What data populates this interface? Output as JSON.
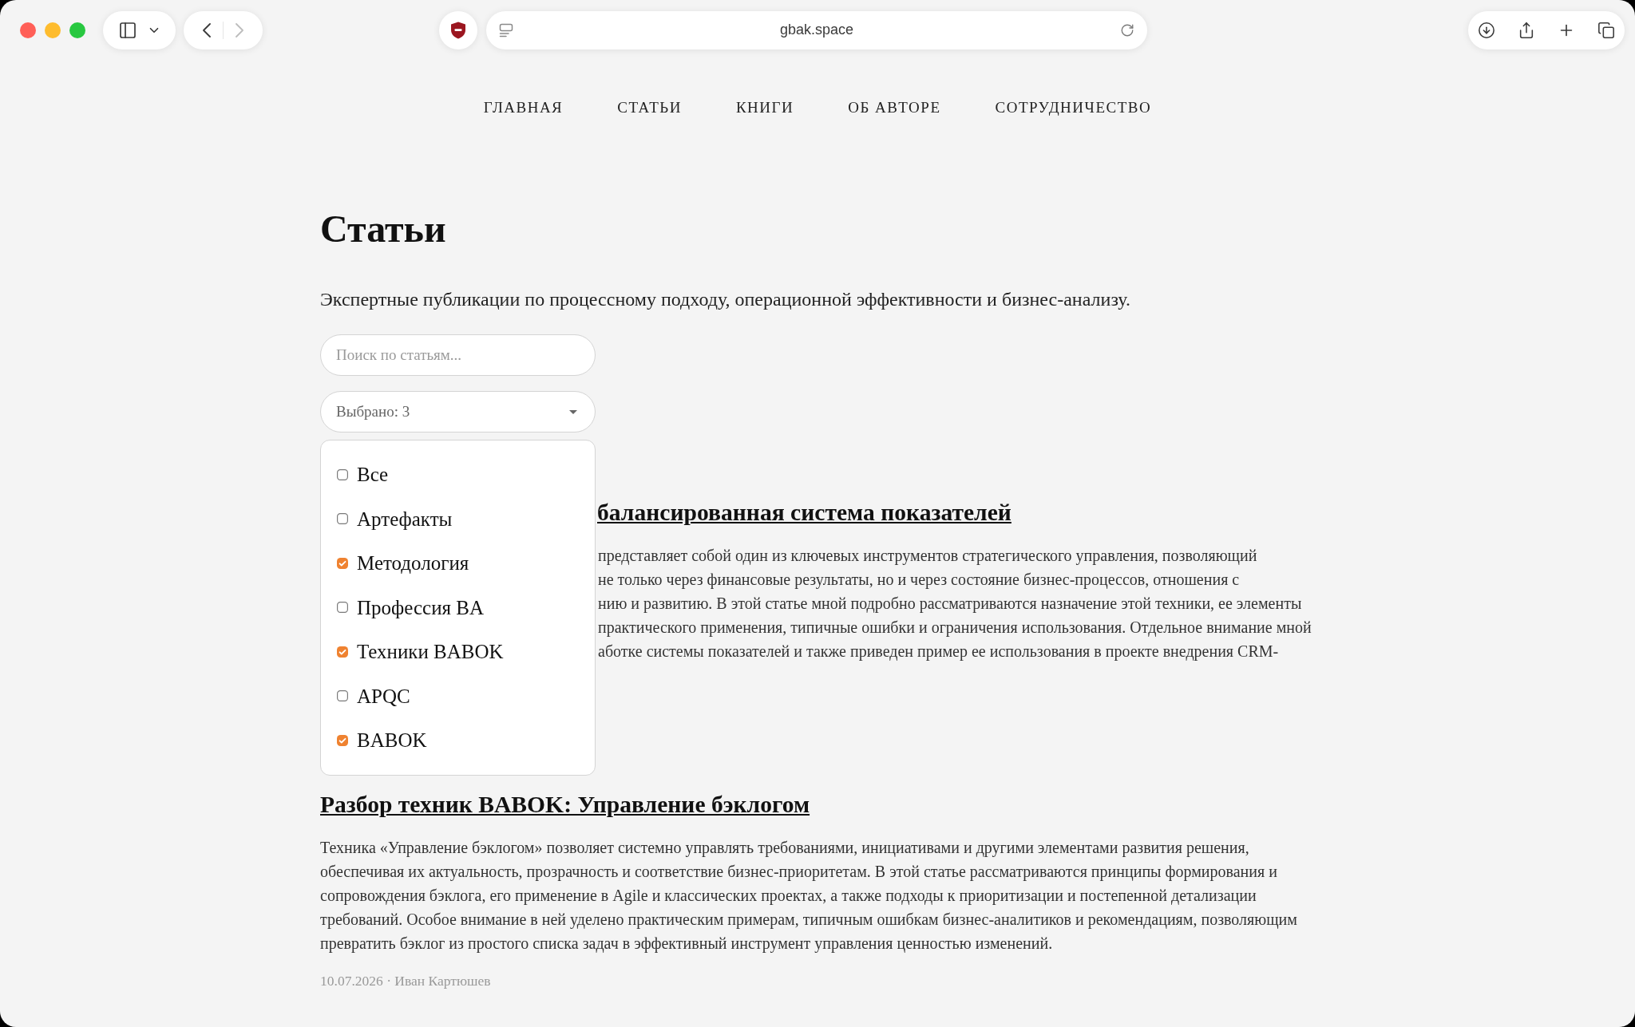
{
  "browser": {
    "address": "gbak.space",
    "back_disabled": false,
    "forward_disabled": true
  },
  "nav": [
    "ГЛАВНАЯ",
    "СТАТЬИ",
    "КНИГИ",
    "ОБ АВТОРЕ",
    "СОТРУДНИЧЕСТВО"
  ],
  "page": {
    "title": "Статьи",
    "subtitle": "Экспертные публикации по процессному подходу, операционной эффективности и бизнес-анализу.",
    "search": {
      "placeholder": "Поиск по статьям..."
    },
    "filter": {
      "value": "Выбрано: 3",
      "expanded": true,
      "options": [
        {
          "label": "Все",
          "checked": false
        },
        {
          "label": "Артефакты",
          "checked": false
        },
        {
          "label": "Методология",
          "checked": true
        },
        {
          "label": "Профессия BA",
          "checked": false
        },
        {
          "label": "Техники BABOK",
          "checked": true
        },
        {
          "label": "APQC",
          "checked": false
        },
        {
          "label": "BABOK",
          "checked": true
        }
      ]
    },
    "articles": [
      {
        "kind": "partly_covered",
        "title": "балансированная система показателей",
        "lines": [
          "представляет собой один из ключевых инструментов стратегического управления, позволяющий",
          "не только через финансовые результаты, но и через состояние бизнес-процессов, отношения с",
          "нию и развитию. В этой статье мной подробно рассматриваются назначение этой техники, ее элементы",
          "практического применения, типичные ошибки и ограничения использования. Отдельное внимание мной",
          "аботке системы показателей и также приведен пример ее использования в проекте внедрения CRM-"
        ]
      },
      {
        "kind": "full",
        "title": "Разбор техник BABOK: Управление бэклогом",
        "excerpt": "Техника «Управление бэклогом» позволяет системно управлять требованиями, инициативами и другими элементами развития решения, обеспечивая их актуальность, прозрачность и соответствие бизнес-приоритетам. В этой статье рассматриваются принципы формирования и сопровождения бэклога, его применение в Agile и классических проектах, а также подходы к приоритизации и постепенной детализации требований. Особое внимание в ней уделено практическим примерам, типичным ошибкам бизнес-аналитиков и рекомендациям, позволяющим превратить бэклог из простого списка задач в эффективный инструмент управления ценностью изменений.",
        "meta": "10.07.2026 · Иван Картюшев"
      }
    ]
  }
}
